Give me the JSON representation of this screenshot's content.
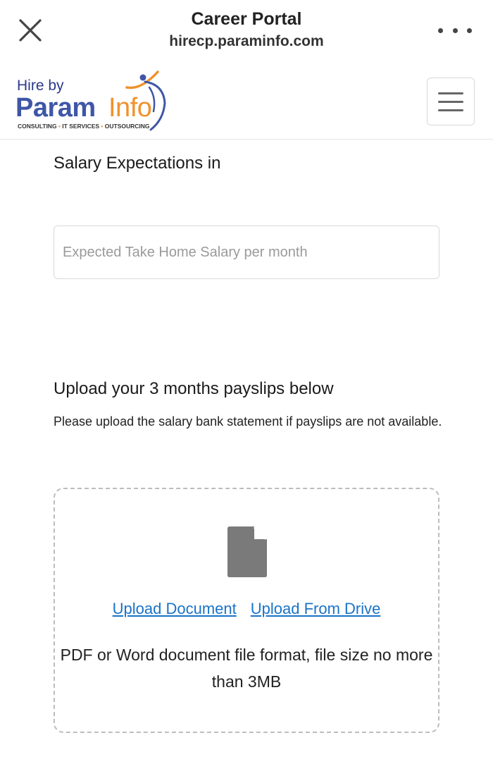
{
  "browser": {
    "title": "Career Portal",
    "url": "hirecp.paraminfo.com"
  },
  "logo": {
    "hire_by": "Hire by",
    "brand_param": "Param",
    "brand_info": "Info",
    "tagline_1": "CONSULTING",
    "tagline_2": "IT SERVICES",
    "tagline_3": "OUTSOURCING",
    "accent_color": "#f0922c",
    "brand_color": "#3f56a8"
  },
  "salary": {
    "section_title": "Salary Expectations in",
    "input_placeholder": "Expected Take Home Salary per month",
    "input_value": ""
  },
  "payslip": {
    "section_title": "Upload your 3 months payslips below",
    "description": "Please upload the salary bank statement if payslips are not available.",
    "upload_document_label": "Upload Document",
    "upload_drive_label": "Upload From Drive",
    "hint": "PDF or Word document file format, file size no more than 3MB",
    "link_color": "#1a73c8"
  }
}
